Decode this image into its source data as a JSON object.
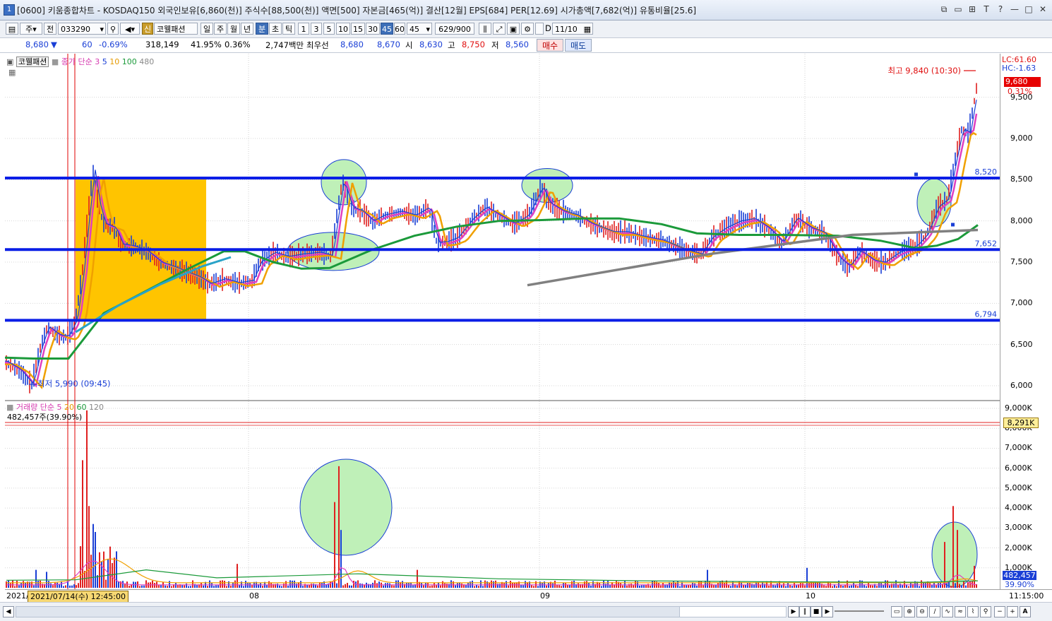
{
  "window": {
    "index_badge": "1",
    "title": "[0600] 키움종합차트 - KOSDAQ150 외국인보유[6,860(천)] 주식수[88,500(천)] 액면[500] 자본금[465(억)] 결산[12월] EPS[684] PER[12.69] 시가총액[7,682(억)] 유통비율[25.6]",
    "controls": [
      "⧉",
      "▭",
      "⊞",
      "T",
      "?",
      "—",
      "□",
      "✕"
    ]
  },
  "toolbar": {
    "period_weekly": "주",
    "prev": "전",
    "stock_code": "033290",
    "stock_name": "코웰패션",
    "period_tabs": [
      "일",
      "주",
      "월",
      "년",
      "분",
      "초",
      "틱"
    ],
    "active_period": "분",
    "intervals": [
      "1",
      "3",
      "5",
      "10",
      "15",
      "30",
      "45",
      "60"
    ],
    "active_interval": "45",
    "interval_select": "45",
    "count": "629/900",
    "date_check_label": "D",
    "date": "11/10"
  },
  "quote": {
    "price": "8,680",
    "change_arrow": "▼",
    "change": "60",
    "change_pct": "-0.69%",
    "volume": "318,149",
    "vol_ratio": "41.95%",
    "turnover": "0.36%",
    "amount": "2,747백만",
    "best_label": "최우선",
    "best_ask": "8,680",
    "best_bid": "8,670",
    "open_label": "시",
    "open": "8,630",
    "high_label": "고",
    "high": "8,750",
    "low_label": "저",
    "low": "8,560",
    "buy_button": "매수",
    "sell_button": "매도"
  },
  "price_pane": {
    "stock_tag": "코웰패션",
    "ma_legend": {
      "label": "종가 단순",
      "periods": [
        "3",
        "5",
        "10",
        "100",
        "480"
      ]
    },
    "lc": "LC:61.60",
    "hc": "HC:-1.63",
    "current_price": "9,680",
    "current_pct": "0.31%",
    "high_annotation": "최고 9,840 (10:30)",
    "low_annotation": "최저 5,990 (09:45)",
    "hlines": [
      {
        "label": "8,520",
        "value": 8520
      },
      {
        "label": "7,652",
        "value": 7652
      },
      {
        "label": "6,794",
        "value": 6794
      }
    ],
    "y_ticks": [
      "9,500",
      "9,000",
      "8,500",
      "8,000",
      "7,500",
      "7,000",
      "6,500",
      "6,000"
    ],
    "y_tick_values": [
      9500,
      9000,
      8500,
      8000,
      7500,
      7000,
      6500,
      6000
    ],
    "x_ticks": [
      "08",
      "09",
      "10"
    ]
  },
  "volume_pane": {
    "legend_label": "거래량 단순",
    "periods": [
      "5",
      "20",
      "60",
      "120"
    ],
    "current": "482,457주(39.90%)",
    "ref_label": "8,291K",
    "cur_label": "482,457",
    "cur_pct": "39.90%",
    "y_ticks": [
      "9,000K",
      "8,000K",
      "7,000K",
      "6,000K",
      "5,000K",
      "4,000K",
      "3,000K",
      "2,000K",
      "1,000K"
    ],
    "y_tick_values": [
      9000,
      8000,
      7000,
      6000,
      5000,
      4000,
      3000,
      2000,
      1000
    ]
  },
  "bottom": {
    "year_prefix": "2021/",
    "cursor_date": "2021/07/14(수) 12:45:00",
    "month_labels": [
      "08",
      "09",
      "10"
    ],
    "time": "11:15:00"
  },
  "colors": {
    "support_line": "#0a1ee6",
    "ma3": "#e040c0",
    "ma5": "#1a3fd6",
    "ma10": "#f0a000",
    "ma100": "#1b9a3a",
    "ma480": "#29a3c8",
    "trend": "#808080",
    "box": "#ffc400",
    "highlight": "#bff0b8"
  }
}
